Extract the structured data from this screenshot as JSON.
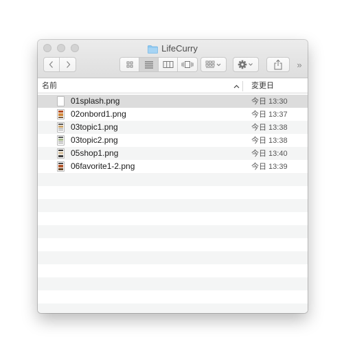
{
  "window": {
    "title": "LifeCurry",
    "folder_icon": "folder-icon"
  },
  "toolbar": {
    "back_icon": "chevron-left-icon",
    "forward_icon": "chevron-right-icon",
    "view_modes": [
      "icon-view-icon",
      "list-view-icon",
      "column-view-icon",
      "cover-flow-icon"
    ],
    "active_view": "list-view-icon",
    "arrange_icon": "arrange-grid-icon",
    "action_icon": "gear-icon",
    "share_icon": "share-icon",
    "overflow_label": "»"
  },
  "columns": {
    "name": "名前",
    "date_modified": "変更日",
    "sort": "ascending"
  },
  "files": [
    {
      "name": "01splash.png",
      "date": "今日 13:30",
      "selected": true
    },
    {
      "name": "02onbord1.png",
      "date": "今日 13:37",
      "selected": false
    },
    {
      "name": "03topic1.png",
      "date": "今日 13:38",
      "selected": false
    },
    {
      "name": "03topic2.png",
      "date": "今日 13:38",
      "selected": false
    },
    {
      "name": "05shop1.png",
      "date": "今日 13:40",
      "selected": false
    },
    {
      "name": "06favorite1-2.png",
      "date": "今日 13:39",
      "selected": false
    }
  ],
  "colors": {
    "selection": "#dcdcdc",
    "stripe": "#f4f5f5",
    "folder_blue": "#8cc7ef"
  }
}
